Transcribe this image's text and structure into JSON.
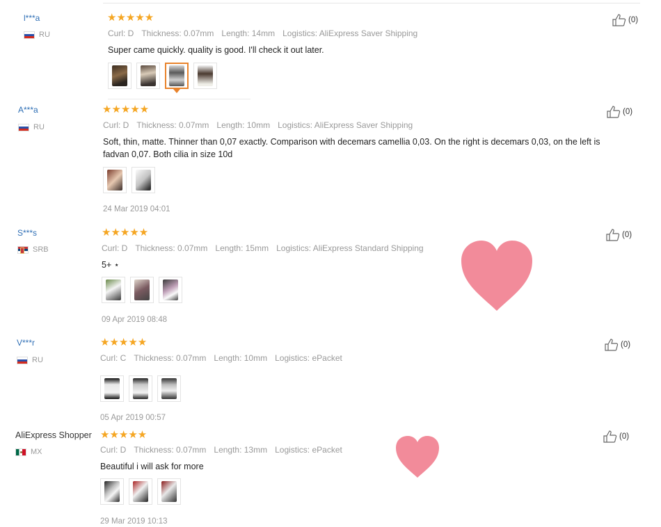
{
  "reviews": [
    {
      "user": "l***a",
      "country": "RU",
      "stars": "★★★★★",
      "curl": "Curl: D",
      "thickness": "Thickness: 0.07mm",
      "length": "Length: 14mm",
      "logistics": "Logistics: AliExpress Saver Shipping",
      "text": "Super came quickly. quality is good. I'll check it out later.",
      "date": "",
      "likes": "(0)"
    },
    {
      "user": "A***a",
      "country": "RU",
      "stars": "★★★★★",
      "curl": "Curl: D",
      "thickness": "Thickness: 0.07mm",
      "length": "Length: 10mm",
      "logistics": "Logistics: AliExpress Saver Shipping",
      "text": "Soft, thin, matte. Thinner than 0,07 exactly. Comparison with decemars camellia 0,03. On the right is decemars 0,03, on the left is fadvan 0,07. Both cilia in size 10d",
      "date": "24 Mar 2019 04:01",
      "likes": "(0)"
    },
    {
      "user": "S***s",
      "country": "SRB",
      "stars": "★★★★★",
      "curl": "Curl: D",
      "thickness": "Thickness: 0.07mm",
      "length": "Length: 15mm",
      "logistics": "Logistics: AliExpress Standard Shipping",
      "text": "5+ ⋆",
      "date": "09 Apr 2019 08:48",
      "likes": "(0)"
    },
    {
      "user": "V***r",
      "country": "RU",
      "stars": "★★★★★",
      "curl": "Curl: C",
      "thickness": "Thickness: 0.07mm",
      "length": "Length: 10mm",
      "logistics": "Logistics: ePacket",
      "text": "",
      "date": "05 Apr 2019 00:57",
      "likes": "(0)"
    },
    {
      "user": "AliExpress Shopper",
      "country": "MX",
      "stars": "★★★★★",
      "curl": "Curl: D",
      "thickness": "Thickness: 0.07mm",
      "length": "Length: 13mm",
      "logistics": "Logistics: ePacket",
      "text": "Beautiful i will ask for more",
      "date": "29 Mar 2019 10:13",
      "likes": "(0)"
    }
  ],
  "icons": {
    "like": "thumbs-up-icon",
    "flag_ru": "russia-flag-icon",
    "flag_srb": "serbia-flag-icon",
    "flag_mx": "mexico-flag-icon",
    "decor": "heart-sticker"
  },
  "colors": {
    "stars": "#f5a623",
    "username": "#2f6fb5",
    "selected_thumb": "#e8822a",
    "heart": "#f28b9a"
  },
  "rating": {
    "max": 5,
    "values": [
      5,
      5,
      5,
      5,
      5
    ]
  }
}
